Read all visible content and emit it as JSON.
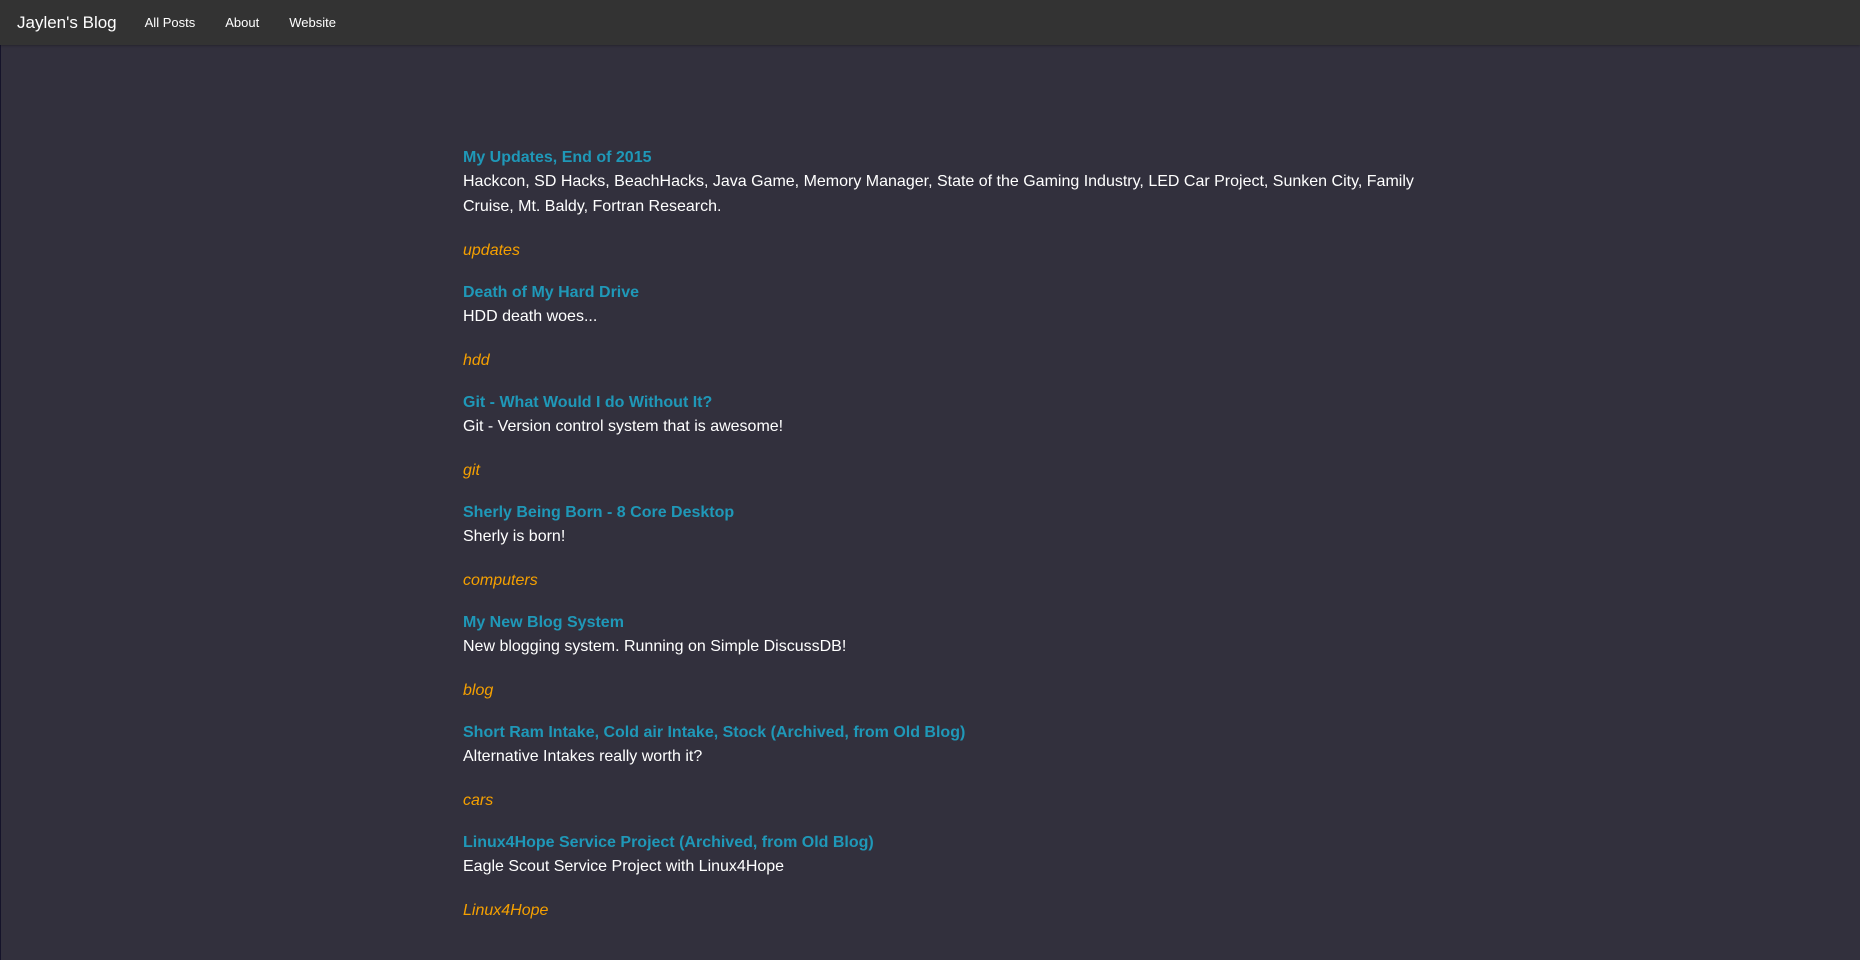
{
  "nav": {
    "brand": "Jaylen's Blog",
    "links": [
      {
        "label": "All Posts"
      },
      {
        "label": "About"
      },
      {
        "label": "Website"
      }
    ]
  },
  "posts": [
    {
      "title": "My Updates, End of 2015",
      "summary": "Hackcon, SD Hacks, BeachHacks, Java Game, Memory Manager, State of the Gaming Industry, LED Car Project, Sunken City, Family Cruise, Mt. Baldy, Fortran Research.",
      "tag": "updates"
    },
    {
      "title": "Death of My Hard Drive",
      "summary": "HDD death woes...",
      "tag": "hdd"
    },
    {
      "title": "Git - What Would I do Without It?",
      "summary": "Git - Version control system that is awesome!",
      "tag": "git"
    },
    {
      "title": "Sherly Being Born - 8 Core Desktop",
      "summary": "Sherly is born!",
      "tag": "computers"
    },
    {
      "title": "My New Blog System",
      "summary": "New blogging system. Running on Simple DiscussDB!",
      "tag": "blog"
    },
    {
      "title": "Short Ram Intake, Cold air Intake, Stock (Archived, from Old Blog)",
      "summary": "Alternative Intakes really worth it?",
      "tag": "cars"
    },
    {
      "title": "Linux4Hope Service Project (Archived, from Old Blog)",
      "summary": "Eagle Scout Service Project with Linux4Hope",
      "tag": "Linux4Hope"
    }
  ],
  "colors": {
    "background": "#32303d",
    "navbar": "#333333",
    "title": "#1f98b8",
    "tag": "#f5a000",
    "text": "#ffffff"
  }
}
